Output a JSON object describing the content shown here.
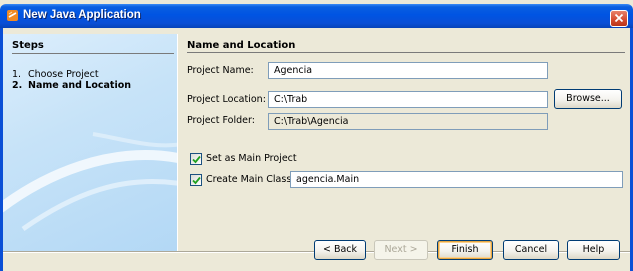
{
  "window": {
    "title": "New Java Application"
  },
  "steps": {
    "title": "Steps",
    "items": [
      {
        "num": "1.",
        "label": "Choose Project",
        "active": false
      },
      {
        "num": "2.",
        "label": "Name and Location",
        "active": true
      }
    ]
  },
  "panel": {
    "title": "Name and Location",
    "project_name_label": "Project Name:",
    "project_name_value": "Agencia",
    "project_location_label": "Project Location:",
    "project_location_value": "C:\\Trab",
    "browse_label": "Browse...",
    "project_folder_label": "Project Folder:",
    "project_folder_value": "C:\\Trab\\Agencia",
    "main_project_label": "Set as Main Project",
    "main_project_checked": true,
    "main_class_label": "Create Main Class",
    "main_class_checked": true,
    "main_class_value": "agencia.Main"
  },
  "buttons": {
    "back": "< Back",
    "next": "Next >",
    "finish": "Finish",
    "cancel": "Cancel",
    "help": "Help"
  },
  "colors": {
    "titlebar": "#0054e3",
    "dialog_bg": "#ece9d8",
    "steps_bg": "#c7e3f8",
    "field_border": "#7f9db9"
  },
  "icons": {
    "title": "java-cup-icon",
    "close": "close-icon",
    "check": "checkmark-icon"
  }
}
